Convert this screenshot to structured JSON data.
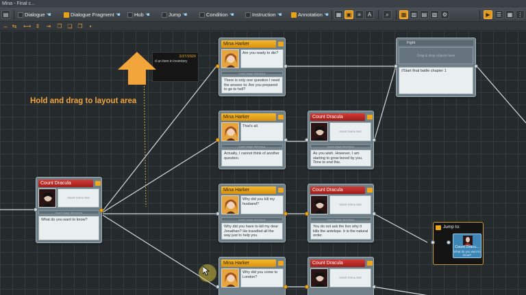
{
  "window": {
    "title": "Mina - Final c..."
  },
  "toolbar": {
    "items": [
      {
        "label": "Dialogue",
        "icon": "dialogue-icon"
      },
      {
        "label": "Dialogue Fragment",
        "icon": "dialogue-fragment-icon"
      },
      {
        "label": "Hub",
        "icon": "hub-icon"
      },
      {
        "label": "Jump",
        "icon": "jump-icon"
      },
      {
        "label": "Condition",
        "icon": "condition-icon"
      },
      {
        "label": "Instruction",
        "icon": "instruction-icon"
      },
      {
        "label": "Annotation",
        "icon": "annotation-icon"
      }
    ]
  },
  "hint": {
    "text": "Hold and drag to layout area"
  },
  "annotation": {
    "date": "2/27/2020",
    "text": "d an item in inventory"
  },
  "nodes": {
    "dracula_main": {
      "speaker": "Count Dracula",
      "menu": "Insert menu text",
      "stage": "Insert stage directions",
      "text": "What do you want to know?"
    },
    "mina_1": {
      "speaker": "Mina Harker",
      "menu": "Are you ready to die?",
      "stage": "Insert stage directions",
      "text": "There is only one question I need the answer to: Are you prepared to go to hell?"
    },
    "mina_2": {
      "speaker": "Mina Harker",
      "menu": "That's all.",
      "stage": "Insert stage directions",
      "text": "Actually, I cannot think of another question."
    },
    "dracula_2": {
      "speaker": "Count Dracula",
      "menu": "Insert menu text",
      "stage": "Insert stage directions",
      "text": "As you wish. However, I am starting to grow bored by you. Time to end this."
    },
    "mina_3": {
      "speaker": "Mina Harker",
      "menu": "Why did you kill my husband?",
      "stage": "Insert stage directions",
      "text": "Why did you have to kill my dear Jonathan? He travelled all the way just to help you."
    },
    "dracula_3": {
      "speaker": "Count Dracula",
      "menu": "Insert menu text",
      "stage": "Insert stage directions",
      "text": "You do not ask the lion why it kills the antelope. It is the natural order."
    },
    "mina_4": {
      "speaker": "Mina Harker",
      "menu": "Why did you come to London?"
    },
    "dracula_4": {
      "speaker": "Count Dracula",
      "menu": "Insert menu text"
    },
    "fight": {
      "title": "Fight",
      "drop": "Drag & drop objects here",
      "text": "//Start final battle chapter 1"
    },
    "jump": {
      "label": "Jump to:",
      "target": "Count Dracu...",
      "sub": "What do you want to know?"
    }
  },
  "colors": {
    "mina_header": "#f0a81a",
    "dracula_header": "#b72a25",
    "accent": "#e49a18",
    "hint": "#f2a53a"
  }
}
